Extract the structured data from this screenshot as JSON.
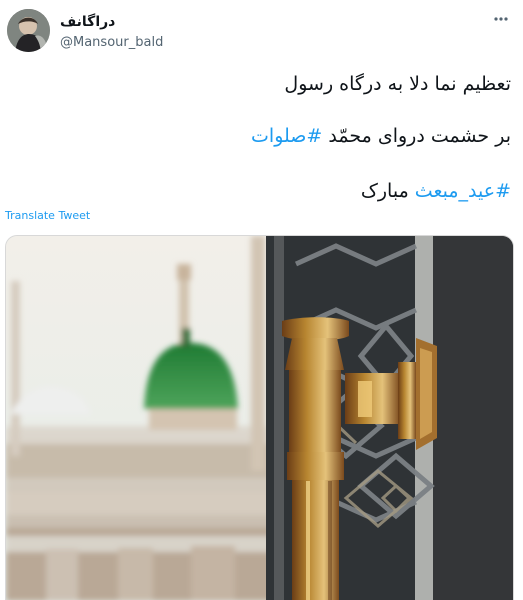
{
  "tweet": {
    "display_name": "دراگانف",
    "handle": "@Mansour_bald",
    "more_icon": "more-horizontal-icon",
    "text_lines": {
      "line1": "تعظیم نما دلا به درگاه رسول",
      "line2_prefix": "بر حشمت دروای محمّد ",
      "line2_hashtag": "#صلوات",
      "line3_hashtag": "#عید_مبعث",
      "line3_suffix": " مبارک"
    },
    "translate_label": "Translate Tweet",
    "media": {
      "alt_semantic": "blurred green dome mosque behind golden door handle"
    },
    "colors": {
      "link_blue": "#1d9bf0",
      "primary_text": "#0f1419",
      "secondary_text": "#536471",
      "dome_green": "#2f8f43",
      "gold": "#b9872d"
    }
  }
}
